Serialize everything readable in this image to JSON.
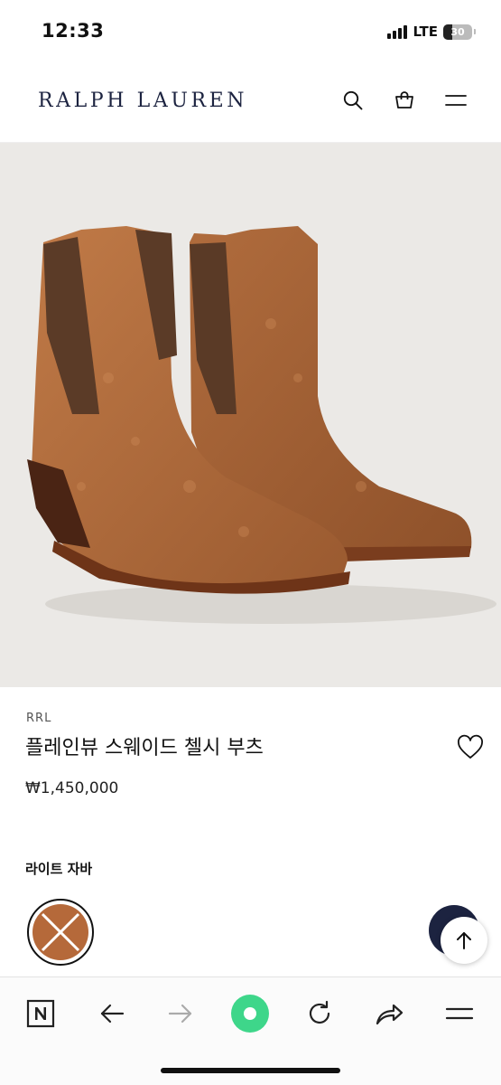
{
  "status": {
    "time": "12:33",
    "network": "LTE",
    "battery_level": "30",
    "battery_fraction": 0.3
  },
  "header": {
    "logo": "RALPH LAUREN",
    "icons": [
      "search-icon",
      "shopping-bag-icon",
      "menu-icon"
    ]
  },
  "product": {
    "image": "brown-suede-chelsea-boots",
    "brand": "RRL",
    "name": "플레인뷰 스웨이드 첼시 부츠",
    "price": "₩1,450,000",
    "wishlist_icon": "heart-icon"
  },
  "color": {
    "selected_name": "라이트 자바",
    "swatch_hex": "#b5693a"
  },
  "fabs": {
    "chat_color": "#1c2340",
    "scroll_top_icon": "arrow-up-icon"
  },
  "browser_toolbar": {
    "items": [
      "naver-icon",
      "back-arrow-icon",
      "forward-arrow-icon",
      "green-dot-icon",
      "refresh-icon",
      "share-icon",
      "menu-icon"
    ],
    "accent": "#3ed68a"
  }
}
